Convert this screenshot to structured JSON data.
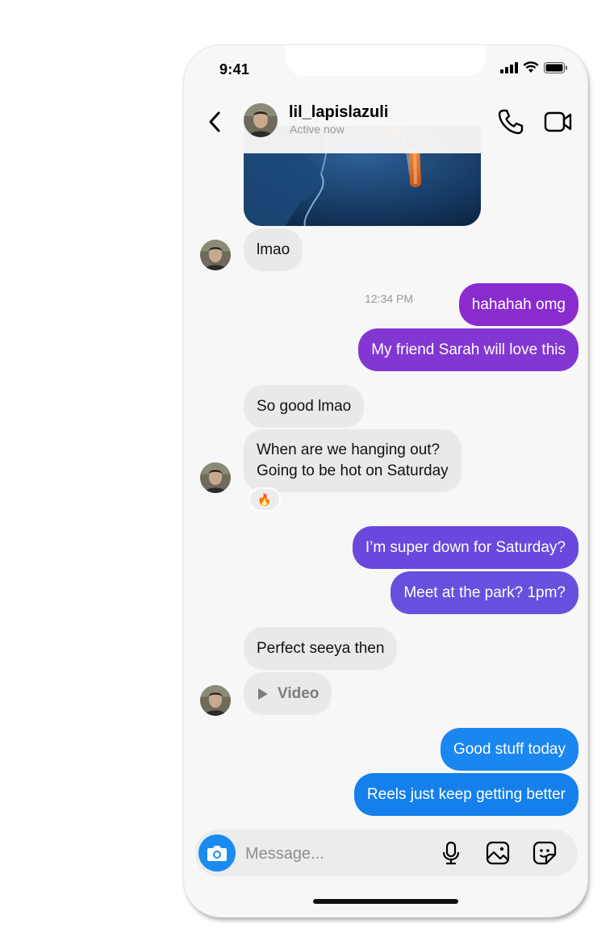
{
  "status_bar": {
    "time": "9:41"
  },
  "header": {
    "username": "lil_lapislazuli",
    "status": "Active now"
  },
  "messages": [
    {
      "from": "them",
      "text": "lmao"
    },
    {
      "from": "me",
      "text": "hahahah omg",
      "timestamp": "12:34 PM"
    },
    {
      "from": "me",
      "text": "My friend Sarah will love this"
    },
    {
      "from": "them",
      "text": "So good lmao"
    },
    {
      "from": "them",
      "lines": [
        "When are we hanging out?",
        "Going to be hot on Saturday"
      ],
      "reaction": "🔥"
    },
    {
      "from": "me",
      "text": "I’m super down for Saturday?"
    },
    {
      "from": "me",
      "text": "Meet at the park? 1pm?"
    },
    {
      "from": "them",
      "text": "Perfect seeya then"
    },
    {
      "from": "them",
      "text": "Video",
      "type": "video"
    },
    {
      "from": "me",
      "text": "Good stuff today"
    },
    {
      "from": "me",
      "text": "Reels just keep getting better"
    }
  ],
  "composer": {
    "placeholder": "Message..."
  },
  "icons": {
    "back": "chevron-left-icon",
    "call": "phone-icon",
    "video_call": "video-camera-icon",
    "camera": "camera-icon",
    "mic": "microphone-icon",
    "gallery": "image-icon",
    "sticker": "sticker-icon"
  },
  "colors": {
    "incoming_bubble": "#e9e9ea",
    "outgoing_purple": "#8e2ad0",
    "outgoing_indigo": "#6f47dc",
    "outgoing_blue": "#1a8cf0",
    "camera_button": "#1a8cf0"
  }
}
